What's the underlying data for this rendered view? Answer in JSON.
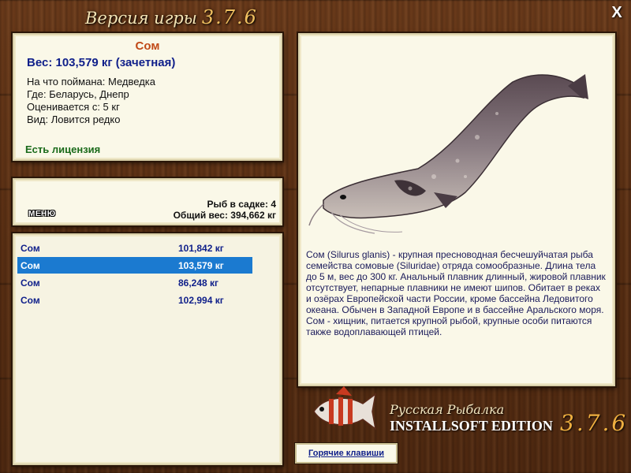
{
  "window": {
    "title": "Версия игры",
    "version": "3.7.6",
    "close_label": "X"
  },
  "fish_info": {
    "name": "Сом",
    "weight": "Вес: 103,579 кг (зачетная)",
    "rows": [
      "На что поймана: Медведка",
      "Где: Беларусь, Днепр",
      "Оценивается с: 5 кг",
      "Вид: Ловится редко"
    ],
    "license": "Есть лицензия"
  },
  "keepnet": {
    "menu_label": "МЕНЮ",
    "count": "Рыб в садке: 4",
    "total": "Общий вес: 394,662 кг"
  },
  "catch_list": [
    {
      "name": "Сом",
      "weight": "101,842 кг",
      "selected": false
    },
    {
      "name": "Сом",
      "weight": "103,579 кг",
      "selected": true
    },
    {
      "name": "Сом",
      "weight": "86,248 кг",
      "selected": false
    },
    {
      "name": "Сом",
      "weight": "102,994 кг",
      "selected": false
    }
  ],
  "description": "Сом (Silurus glanis) - крупная пресноводная бесчешуйчатая рыба семейства сомовые (Siluridae) отряда сомообразные. Длина тела до 5 м, вес до 300 кг. Анальный плавник длинный, жировой плавник отсутствует, непарные плавники не имеют шипов. Обитает в реках и озёрах Европейской части России, кроме бассейна Ледовитого океана. Обычен в Западной Европе и в бассейне Аральского моря. Сом - хищник, питается крупной рыбой, крупные особи питаются также водоплавающей птицей.",
  "branding": {
    "line1": "Русская Рыбалка",
    "line2": "INSTALLSOFT EDITION",
    "version": "3.7.6"
  },
  "hotkeys_label": "Горячие клавиши",
  "colors": {
    "selected_row": "#1b7ad0",
    "fish_name": "#c14a18",
    "weight_text": "#0f1f8a",
    "license_text": "#1a6a1a"
  }
}
